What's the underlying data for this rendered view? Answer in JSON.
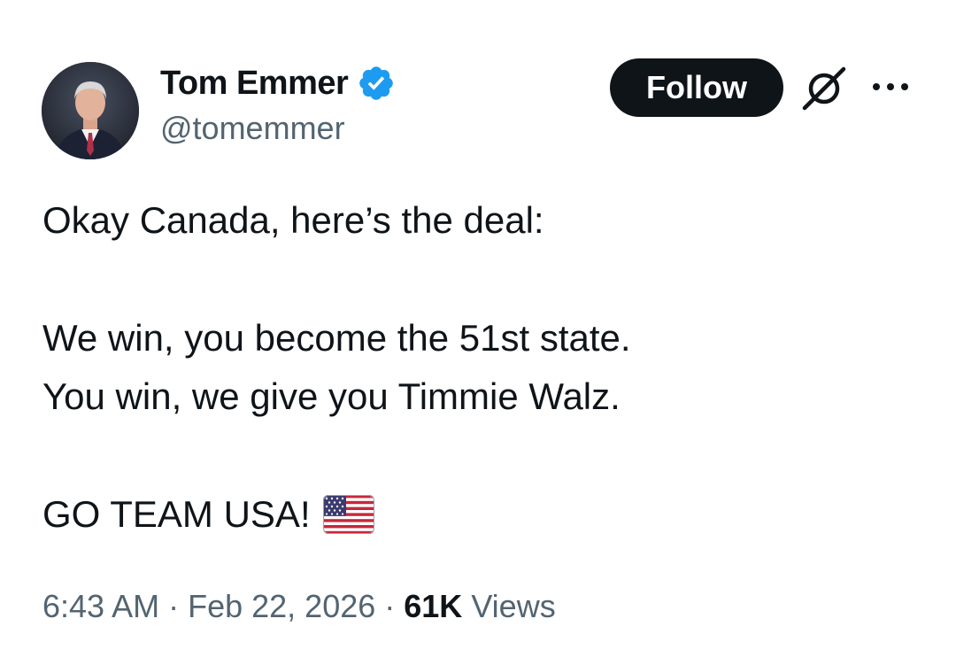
{
  "author": {
    "name": "Tom Emmer",
    "handle": "@tomemmer",
    "verified": true,
    "verified_badge_color": "#1d9bf0"
  },
  "actions": {
    "follow_label": "Follow",
    "grok_icon": "grok-icon",
    "more_icon": "more-icon"
  },
  "tweet": {
    "line1": "Okay Canada, here’s the deal:",
    "line2": "We win, you become the 51st state.",
    "line3": "You win, we give you Timmie Walz.",
    "line4": "GO TEAM USA!",
    "emoji": "us-flag-emoji"
  },
  "meta": {
    "time": "6:43 AM",
    "separator": "·",
    "date": "Feb 22, 2026",
    "views_count": "61K",
    "views_label": "Views"
  },
  "colors": {
    "text_primary": "#0f1419",
    "text_secondary": "#536471",
    "button_bg": "#0f1419",
    "accent": "#1d9bf0"
  }
}
